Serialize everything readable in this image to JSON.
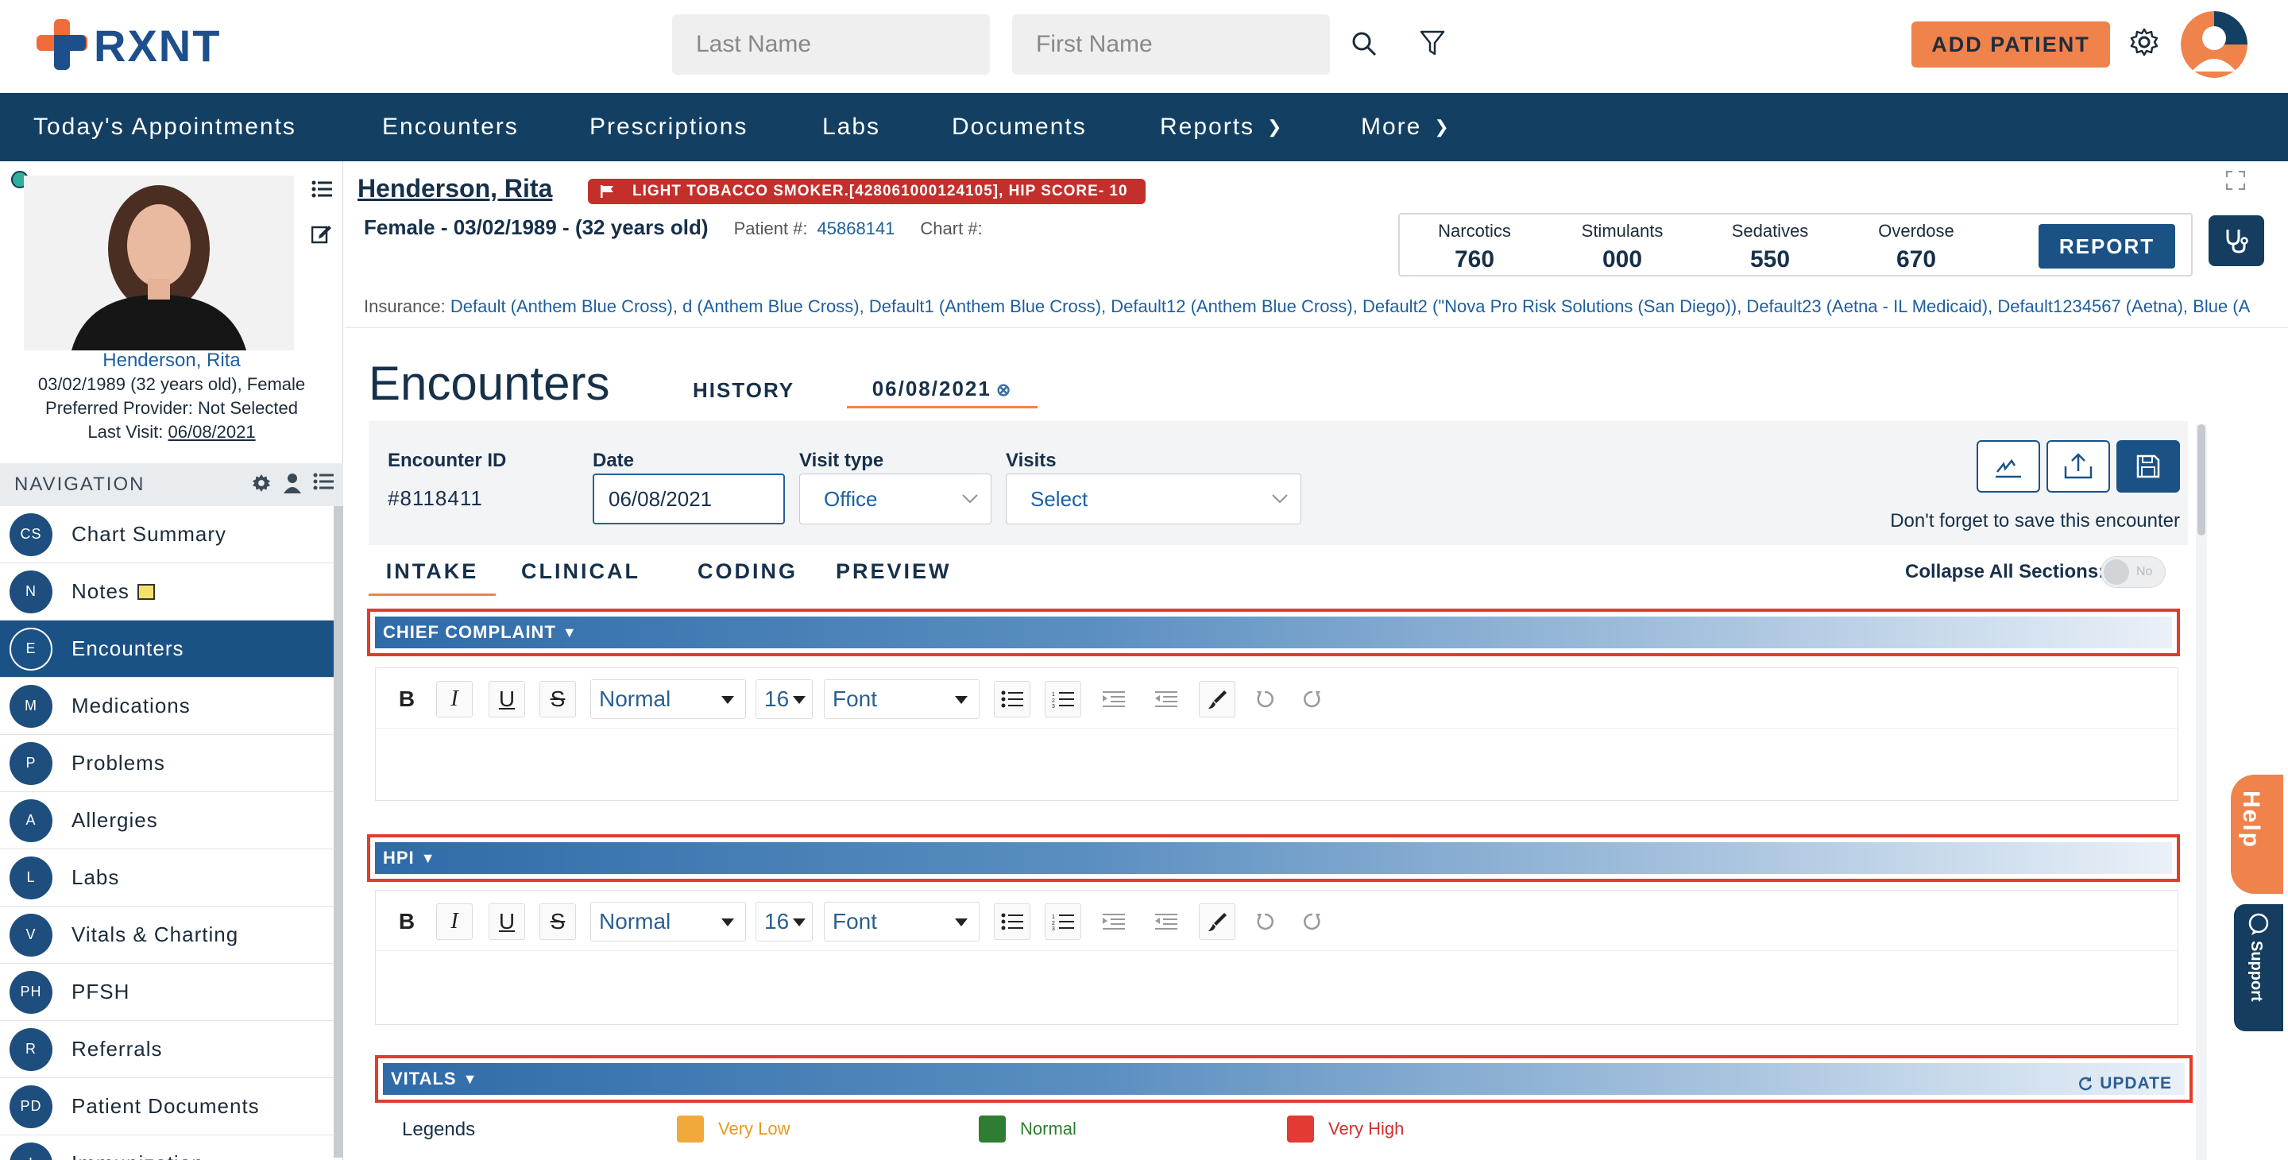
{
  "app": {
    "logo_text": "RXNT",
    "brand_orange": "#f0824b",
    "brand_navy": "#123f62"
  },
  "search": {
    "last_name_placeholder": "Last Name",
    "first_name_placeholder": "First Name"
  },
  "header": {
    "add_patient_label": "ADD PATIENT"
  },
  "nav": {
    "items": [
      "Today's Appointments",
      "Encounters",
      "Prescriptions",
      "Labs",
      "Documents",
      "Reports",
      "More"
    ]
  },
  "patient_card": {
    "name": "Henderson, Rita",
    "dob_line": "03/02/1989 (32 years old), Female",
    "provider_line": "Preferred Provider: Not Selected",
    "last_visit_label": "Last Visit:",
    "last_visit_value": "06/08/2021"
  },
  "side_nav": {
    "heading": "NAVIGATION",
    "items": [
      {
        "badge": "CS",
        "label": "Chart Summary"
      },
      {
        "badge": "N",
        "label": "Notes"
      },
      {
        "badge": "E",
        "label": "Encounters"
      },
      {
        "badge": "M",
        "label": "Medications"
      },
      {
        "badge": "P",
        "label": "Problems"
      },
      {
        "badge": "A",
        "label": "Allergies"
      },
      {
        "badge": "L",
        "label": "Labs"
      },
      {
        "badge": "V",
        "label": "Vitals & Charting"
      },
      {
        "badge": "PH",
        "label": "PFSH"
      },
      {
        "badge": "R",
        "label": "Referrals"
      },
      {
        "badge": "PD",
        "label": "Patient Documents"
      },
      {
        "badge": "I",
        "label": "Immunization"
      }
    ]
  },
  "patient_header": {
    "name": "Henderson, Rita",
    "alert": "LIGHT TOBACCO SMOKER.[428061000124105], HIP SCORE- 10",
    "summary": "Female - 03/02/1989 - (32 years old)",
    "patient_no_label": "Patient #:",
    "patient_no_value": "45868141",
    "chart_no_label": "Chart #:",
    "insurance_label": "Insurance:",
    "insurance_value": "Default (Anthem Blue Cross), d (Anthem Blue Cross), Default1 (Anthem Blue Cross), Default12 (Anthem Blue Cross), Default2 (\"Nova Pro Risk Solutions (San Diego)), Default23 (Aetna - IL Medicaid), Default1234567 (Aetna), Blue (A"
  },
  "pmp": {
    "stats": [
      {
        "label": "Narcotics",
        "value": "760"
      },
      {
        "label": "Stimulants",
        "value": "000"
      },
      {
        "label": "Sedatives",
        "value": "550"
      },
      {
        "label": "Overdose",
        "value": "670"
      }
    ],
    "report_label": "REPORT"
  },
  "encounters": {
    "title": "Encounters",
    "tab_history": "HISTORY",
    "tab_date": "06/08/2021",
    "encounter_id_label": "Encounter ID",
    "encounter_id_value": "#8118411",
    "date_label": "Date",
    "date_value": "06/08/2021",
    "visit_type_label": "Visit type",
    "visit_type_value": "Office",
    "visits_label": "Visits",
    "visits_value": "Select",
    "save_note": "Don't forget to save this encounter",
    "subtabs": [
      "INTAKE",
      "CLINICAL",
      "CODING",
      "PREVIEW"
    ],
    "collapse_label": "Collapse All Sections:",
    "collapse_value": "No"
  },
  "sections": {
    "chief_complaint": "CHIEF COMPLAINT",
    "hpi": "HPI",
    "vitals": "VITALS",
    "update_label": "UPDATE"
  },
  "editor_toolbar": {
    "style": "Normal",
    "size": "16",
    "font": "Font"
  },
  "legends": {
    "label": "Legends",
    "items": [
      {
        "label": "Very Low",
        "color": "#f2a93b"
      },
      {
        "label": "Normal",
        "color": "#2e7d32"
      },
      {
        "label": "Very High",
        "color": "#e53935"
      }
    ]
  },
  "widgets": {
    "help_label": "Help",
    "support_label": "Support"
  }
}
